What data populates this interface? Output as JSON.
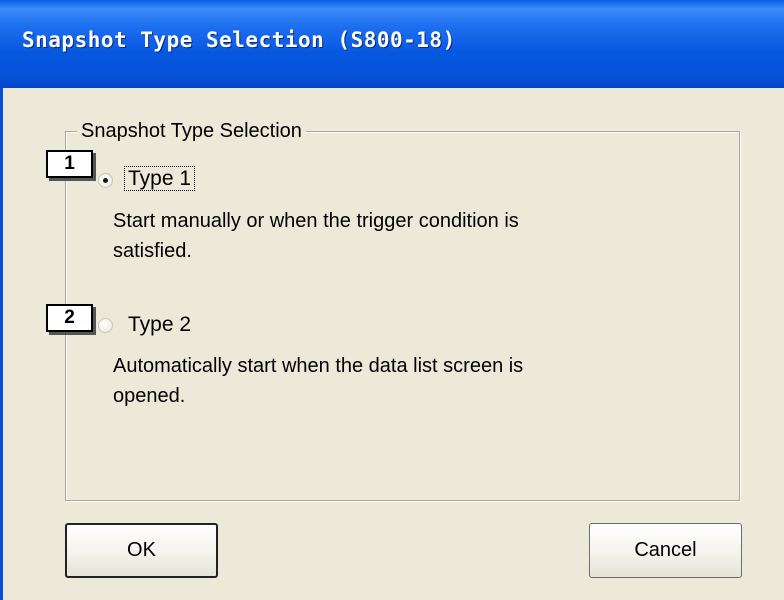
{
  "window": {
    "title": "Snapshot Type Selection (S800-18)"
  },
  "group": {
    "legend": "Snapshot Type Selection"
  },
  "options": [
    {
      "callout": "1",
      "label": "Type 1",
      "selected": true,
      "description_line1": "Start manually or when the trigger condition is",
      "description_line2": "satisfied."
    },
    {
      "callout": "2",
      "label": "Type 2",
      "selected": false,
      "description_line1": "Automatically start when the data list screen is",
      "description_line2": "opened."
    }
  ],
  "buttons": {
    "ok_label": "OK",
    "cancel_label": "Cancel"
  },
  "colors": {
    "titlebar": "#0758e0",
    "dialog_bg": "#ece9d8"
  }
}
